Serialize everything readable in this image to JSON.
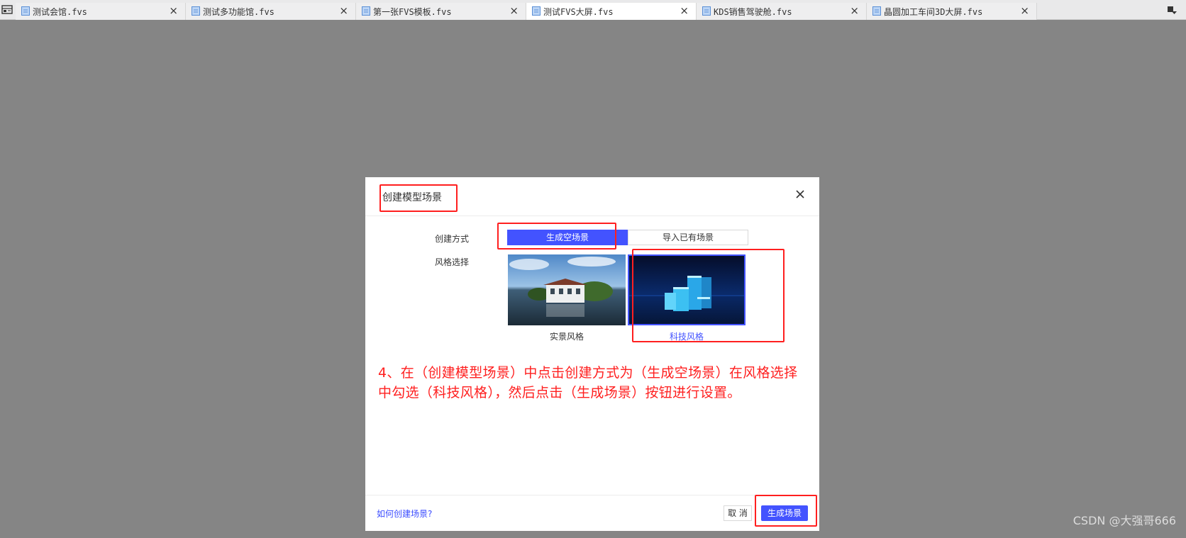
{
  "tabs": [
    {
      "label": "测试会馆.fvs",
      "active": false
    },
    {
      "label": "测试多功能馆.fvs",
      "active": false
    },
    {
      "label": "第一张FVS模板.fvs",
      "active": false
    },
    {
      "label": "测试FVS大屏.fvs",
      "active": true
    },
    {
      "label": "KDS销售驾驶舱.fvs",
      "active": false
    },
    {
      "label": "晶圆加工车间3D大屏.fvs",
      "active": false
    }
  ],
  "dialog": {
    "title": "创建模型场景",
    "create_method_label": "创建方式",
    "style_select_label": "风格选择",
    "segments": {
      "option_empty": "生成空场景",
      "option_import": "导入已有场景",
      "selected": "生成空场景"
    },
    "styles": {
      "realistic": "实景风格",
      "tech": "科技风格",
      "selected": "科技风格"
    },
    "instruction": "4、在（创建模型场景）中点击创建方式为（生成空场景）在风格选择中勾选（科技风格），然后点击（生成场景）按钮进行设置。",
    "help_link": "如何创建场景?",
    "cancel_button": "取 消",
    "generate_button": "生成场景"
  },
  "watermark": "CSDN @大强哥666",
  "colors": {
    "accent": "#4353ff",
    "highlight": "#ff1f1f",
    "overlay": "#858585"
  },
  "icons": [
    "layout-icon",
    "file-icon",
    "close-icon",
    "dropdown-icon"
  ]
}
